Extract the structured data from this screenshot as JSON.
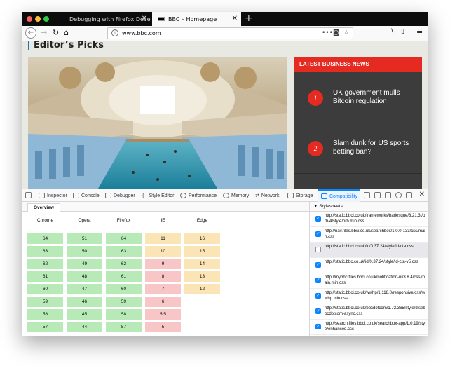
{
  "browser": {
    "tabs": [
      {
        "label": "Debugging with Firefox Developer T",
        "active": false
      },
      {
        "label": "BBC – Homepage",
        "active": true
      }
    ],
    "url": "www.bbc.com"
  },
  "page": {
    "section_title": "Editor’s Picks",
    "news_header": "LATEST BUSINESS NEWS",
    "stories": [
      {
        "number": "1",
        "text": "UK government mulls Bitcoin regulation"
      },
      {
        "number": "2",
        "text": "Slam dunk for US sports betting ban?"
      }
    ]
  },
  "devtools": {
    "tabs": [
      "Inspector",
      "Console",
      "Debugger",
      "Style Editor",
      "Performance",
      "Memory",
      "Network",
      "Storage",
      "Compatibility"
    ],
    "selected_tab": "Compatibility",
    "overview_tab": "Overview",
    "browsers": [
      {
        "name": "Chrome",
        "cells": [
          {
            "v": "64",
            "s": "ok"
          },
          {
            "v": "63",
            "s": "ok"
          },
          {
            "v": "62",
            "s": "ok"
          },
          {
            "v": "61",
            "s": "ok"
          },
          {
            "v": "60",
            "s": "ok"
          },
          {
            "v": "59",
            "s": "ok"
          },
          {
            "v": "58",
            "s": "ok"
          },
          {
            "v": "57",
            "s": "ok"
          }
        ]
      },
      {
        "name": "Opera",
        "cells": [
          {
            "v": "51",
            "s": "ok"
          },
          {
            "v": "50",
            "s": "ok"
          },
          {
            "v": "49",
            "s": "ok"
          },
          {
            "v": "48",
            "s": "ok"
          },
          {
            "v": "47",
            "s": "ok"
          },
          {
            "v": "46",
            "s": "ok"
          },
          {
            "v": "45",
            "s": "ok"
          },
          {
            "v": "44",
            "s": "ok"
          }
        ]
      },
      {
        "name": "Firefox",
        "cells": [
          {
            "v": "64",
            "s": "ok"
          },
          {
            "v": "63",
            "s": "ok"
          },
          {
            "v": "62",
            "s": "ok"
          },
          {
            "v": "61",
            "s": "ok"
          },
          {
            "v": "60",
            "s": "ok"
          },
          {
            "v": "59",
            "s": "ok"
          },
          {
            "v": "58",
            "s": "ok"
          },
          {
            "v": "57",
            "s": "ok"
          }
        ]
      },
      {
        "name": "IE",
        "cells": [
          {
            "v": "11",
            "s": "warn"
          },
          {
            "v": "10",
            "s": "warn"
          },
          {
            "v": "9",
            "s": "bad"
          },
          {
            "v": "8",
            "s": "bad"
          },
          {
            "v": "7",
            "s": "bad"
          },
          {
            "v": "6",
            "s": "bad"
          },
          {
            "v": "5.5",
            "s": "bad"
          },
          {
            "v": "5",
            "s": "bad"
          }
        ]
      },
      {
        "name": "Edge",
        "cells": [
          {
            "v": "16",
            "s": "warn"
          },
          {
            "v": "15",
            "s": "warn"
          },
          {
            "v": "14",
            "s": "warn"
          },
          {
            "v": "13",
            "s": "warn"
          },
          {
            "v": "12",
            "s": "warn"
          }
        ]
      }
    ],
    "stylesheets_header": "Stylesheets",
    "stylesheets": [
      {
        "url": "http://static.bbci.co.uk/frameworks/barlesque/3.21.3t/orb/4/style/orb.min.css",
        "checked": true,
        "highlight": false
      },
      {
        "url": "http://nav.files.bbci.co.uk/searchbox/1.0.0-133/css/main.css",
        "checked": true,
        "highlight": false
      },
      {
        "url": "http://static.bbci.co.uk/id/0.37.24/style/id-cta.css",
        "checked": false,
        "highlight": true
      },
      {
        "url": "http://static.bbc.co.uk/id/0.37.24/style/id-cta-v5.css",
        "checked": true,
        "highlight": false
      },
      {
        "url": "http://mybbc.files.bbci.co.uk/notification-ui/3.8.4/css/main.min.css",
        "checked": true,
        "highlight": false
      },
      {
        "url": "http://static.bbci.co.uk/wwhp/1.118.0/responsive/css/wwhp.min.css",
        "checked": true,
        "highlight": false
      },
      {
        "url": "http://static.bbci.co.uk/bbcdotcom/1.72.365/style/dist/bbcdotcom-async.css",
        "checked": true,
        "highlight": false
      },
      {
        "url": "http://search.files.bbci.co.uk/searchbox-app/1.0.19/style/enhanced.css",
        "checked": true,
        "highlight": false
      }
    ]
  },
  "colors": {
    "accent": "#0a84ff",
    "news_red": "#e52a22",
    "ok": "#b8eab8",
    "warn": "#fbe5b6",
    "bad": "#f8c6c6"
  }
}
